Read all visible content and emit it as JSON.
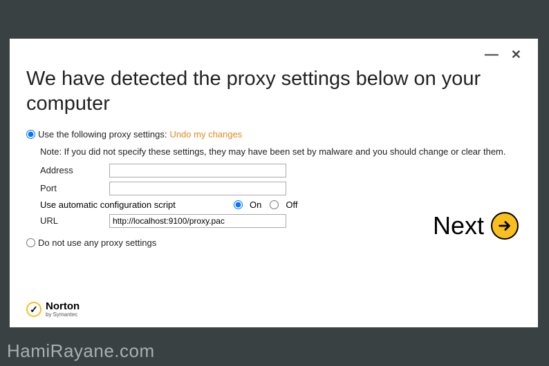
{
  "titlebar": {
    "minimize_glyph": "—",
    "close_glyph": "✕"
  },
  "heading": "We have detected the proxy settings below on your computer",
  "proxy_mode": {
    "use_label": "Use the following proxy settings:",
    "undo_link": "Undo my changes",
    "dont_use_label": "Do not use any proxy settings",
    "selected": "use"
  },
  "note": "Note: If you did not specify these settings, they may have been set by malware and you should change or clear them.",
  "fields": {
    "address": {
      "label": "Address",
      "value": ""
    },
    "port": {
      "label": "Port",
      "value": ""
    },
    "url": {
      "label": "URL",
      "value": "http://localhost:9100/proxy.pac"
    }
  },
  "auto_script": {
    "label": "Use automatic configuration script",
    "on_label": "On",
    "off_label": "Off",
    "value": "on"
  },
  "next_button": "Next",
  "brand": {
    "name": "Norton",
    "byline": "by Symantec",
    "mark": "✓"
  },
  "watermark": "HamiRayane.com",
  "colors": {
    "accent": "#f8bf1e",
    "link": "#e08a1f",
    "page_bg": "#3a4142"
  }
}
